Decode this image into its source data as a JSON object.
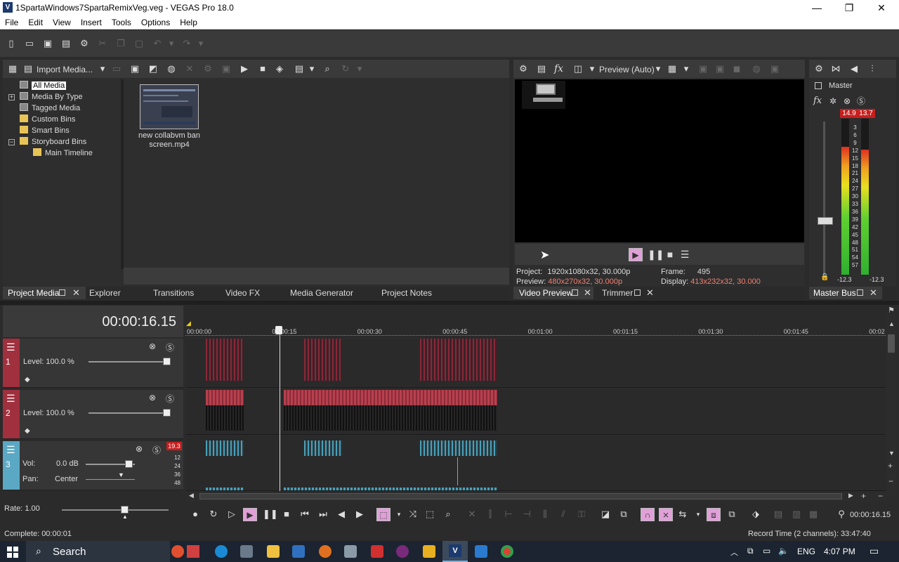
{
  "window": {
    "title": "1SpartaWindows7SpartaRemixVeg.veg - VEGAS Pro 18.0",
    "app_icon": "V",
    "controls": [
      "—",
      "❐",
      "✕"
    ]
  },
  "menu": [
    "File",
    "Edit",
    "View",
    "Insert",
    "Tools",
    "Options",
    "Help"
  ],
  "project_media": {
    "import_label": "Import Media...",
    "tree": [
      {
        "label": "All Media",
        "selected": true
      },
      {
        "label": "Media By Type"
      },
      {
        "label": "Tagged Media"
      },
      {
        "label": "Custom Bins"
      },
      {
        "label": "Smart Bins"
      },
      {
        "label": "Storyboard Bins"
      },
      {
        "label": "Main Timeline"
      }
    ],
    "tree_expanders": [
      "+",
      "−"
    ],
    "media_item": {
      "name_line1": "new collabvm ban",
      "name_line2": "screen.mp4"
    }
  },
  "left_tabs": [
    "Project Media",
    "Explorer",
    "Transitions",
    "Video FX",
    "Media Generator",
    "Project Notes"
  ],
  "video_preview": {
    "fx_label": "fx",
    "quality": "Preview (Auto)",
    "project_label": "Project:",
    "project_value": "1920x1080x32, 30.000p",
    "preview_label": "Preview:",
    "preview_value": "480x270x32, 30.000p",
    "frame_label": "Frame:",
    "frame_value": "495",
    "display_label": "Display:",
    "display_value": "413x232x32, 30.000"
  },
  "preview_tabs": [
    "Video Preview",
    "Trimmer"
  ],
  "master_bus": {
    "title": "Master",
    "fx_label": "fx",
    "peak_left": "14.9",
    "peak_right": "13.7",
    "scale": [
      "3",
      "6",
      "9",
      "12",
      "15",
      "18",
      "21",
      "24",
      "27",
      "30",
      "33",
      "36",
      "39",
      "42",
      "45",
      "48",
      "51",
      "54",
      "57"
    ],
    "bottom_left": "-12.3",
    "bottom_right": "-12.3",
    "tab": "Master Bus",
    "level_left": 0.82,
    "level_right": 0.8
  },
  "timeline": {
    "timecode": "00:00:16.15",
    "ruler": [
      "00:00:00",
      "00:00:15",
      "00:00:30",
      "00:00:45",
      "00:01:00",
      "00:01:15",
      "00:01:30",
      "00:01:45",
      "00:02"
    ],
    "tracks": [
      {
        "number": "1",
        "level_label": "Level:",
        "level_value": "100.0 %",
        "color": "#a0303e"
      },
      {
        "number": "2",
        "level_label": "Level:",
        "level_value": "100.0 %",
        "color": "#a0303e"
      },
      {
        "number": "3",
        "vol_label": "Vol:",
        "vol_value": "0.0 dB",
        "pan_label": "Pan:",
        "pan_value": "Center",
        "peak": "19.3",
        "meter_scale": [
          "12",
          "24",
          "36",
          "48"
        ],
        "color": "#5aa8c4"
      }
    ],
    "rate_label": "Rate:",
    "rate_value": "1.00",
    "end_timecode": "00:00:16.15"
  },
  "status": {
    "complete": "Complete: 00:00:01",
    "record_time": "Record Time (2 channels): 33:47:40"
  },
  "taskbar": {
    "search": "Search",
    "language": "ENG",
    "time": "4:07 PM"
  }
}
